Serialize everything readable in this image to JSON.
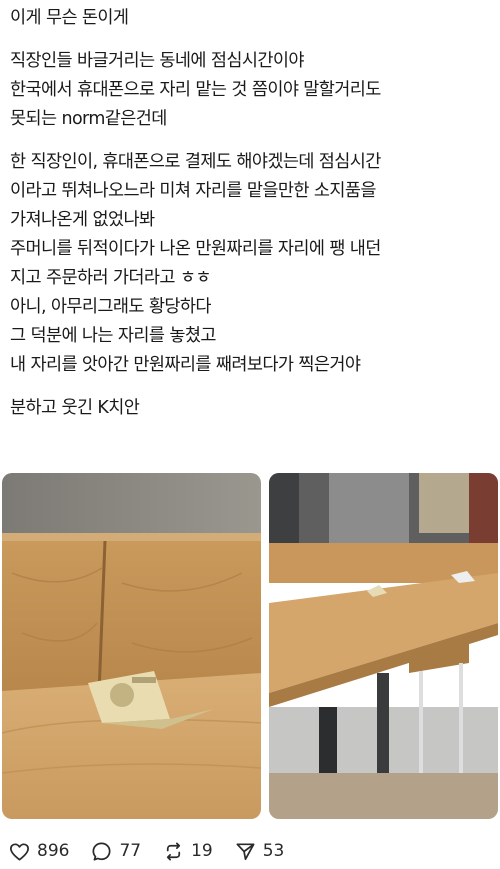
{
  "post": {
    "lines": [
      "이게 무슨 돈이게",
      "",
      "직장인들 바글거리는 동네에 점심시간이야",
      "한국에서 휴대폰으로 자리 맡는 것 쯤이야 말할거리도",
      "못되는 norm같은건데",
      "",
      "한 직장인이, 휴대폰으로 결제도 해야겠는데 점심시간",
      "이라고 뛰쳐나오느라 미쳐 자리를 맡을만한 소지품을",
      "가져나온게 없었나봐",
      "주머니를 뒤적이다가 나온 만원짜리를 자리에 팽 내던",
      "지고 주문하러 가더라고 ㅎㅎ",
      "아니, 아무리그래도 황당하다",
      "그 덕분에 나는 자리를 놓쳤고",
      "내 자리를 앗아간 만원짜리를 째려보다가 찍은거야",
      "",
      "분하고 웃긴 K치안"
    ]
  },
  "stats": {
    "likes": "896",
    "replies": "77",
    "reposts": "19",
    "shares": "53"
  },
  "icons": {
    "like": "heart-icon",
    "reply": "comment-bubble-icon",
    "repost": "repost-arrows-icon",
    "share": "send-icon"
  }
}
